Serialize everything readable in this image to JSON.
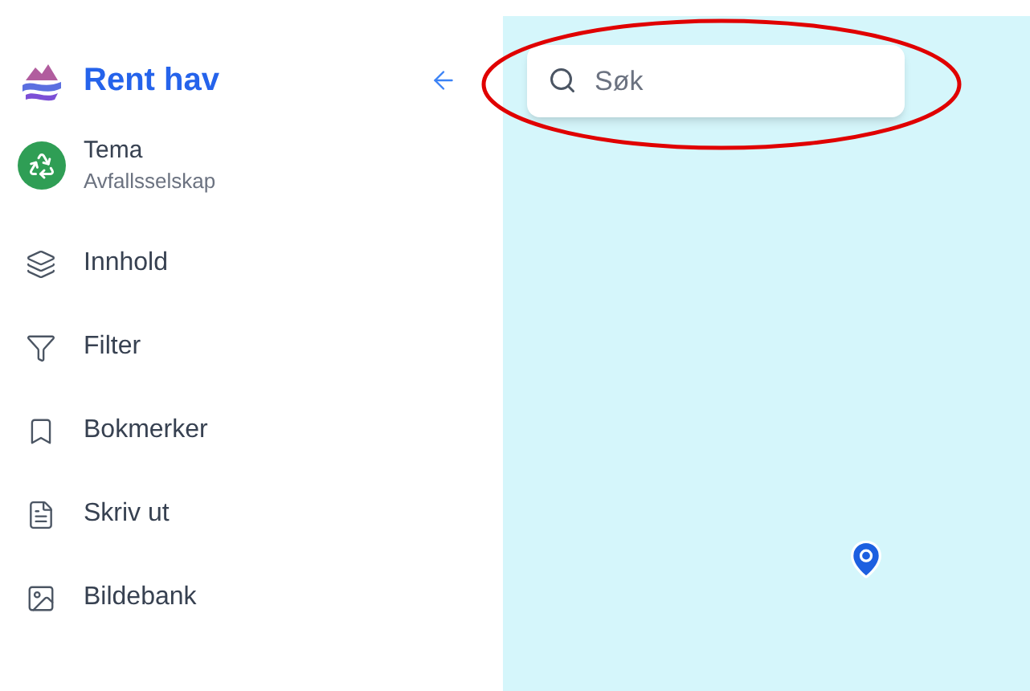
{
  "sidebar": {
    "app_name": "Rent hav",
    "theme": {
      "title": "Tema",
      "subtitle": "Avfallsselskap"
    },
    "items": [
      {
        "label": "Innhold"
      },
      {
        "label": "Filter"
      },
      {
        "label": "Bokmerker"
      },
      {
        "label": "Skriv ut"
      },
      {
        "label": "Bildebank"
      }
    ]
  },
  "search": {
    "placeholder": "Søk"
  }
}
